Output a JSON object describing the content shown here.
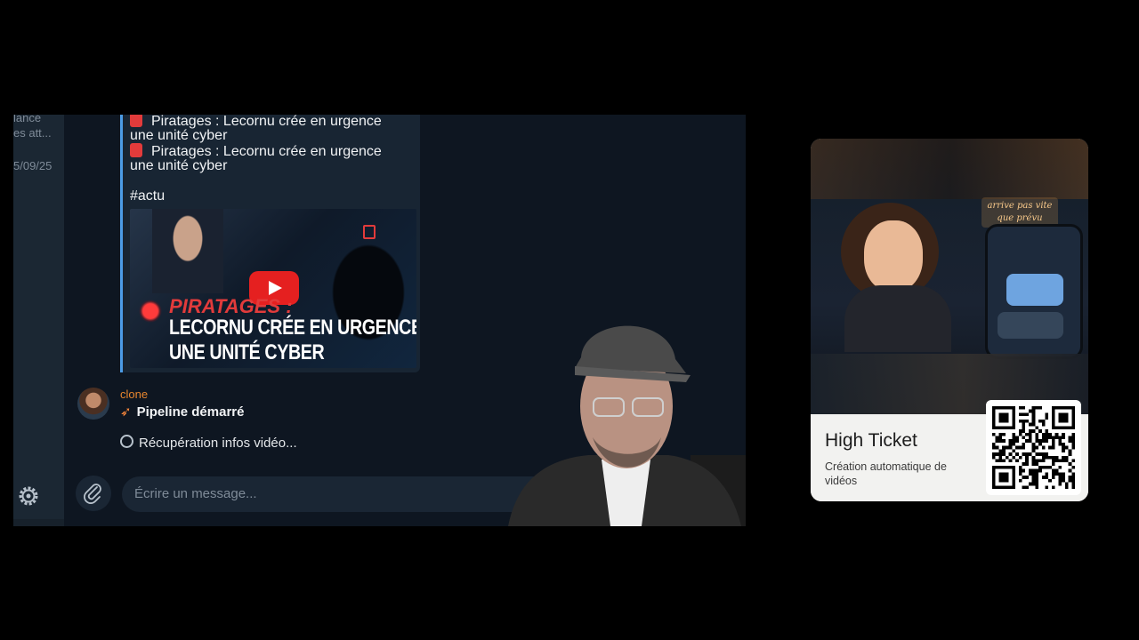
{
  "chat": {
    "sidebar": {
      "preview_line1": "lancé",
      "preview_line2": "es att...",
      "preview_date": "5/09/25"
    },
    "post": {
      "line1": "Piratages : Lecornu crée en urgence",
      "line1b": "une unité cyber",
      "line2": "Piratages : Lecornu crée en urgence",
      "line2b": "une unité cyber",
      "hashtag": "#actu",
      "thumbnail": {
        "headline_red": "PIRATAGES :",
        "headline_line1": "LECORNU CRÉE EN URGENCE",
        "headline_line2": "UNE UNITÉ CYBER"
      }
    },
    "bot_message": {
      "sender": "clone",
      "status": "Pipeline démarré",
      "detail": "Récupération infos vidéo..."
    },
    "composer": {
      "placeholder": "Écrire un message..."
    }
  },
  "card": {
    "neon_text": "arrive pas vite que prévu",
    "title": "High Ticket",
    "subtitle": "Création automatique de vidéos"
  },
  "colors": {
    "sender_name": "#e8862e",
    "accent_bar": "#4c9ce6",
    "app_bg": "#0e1621"
  }
}
